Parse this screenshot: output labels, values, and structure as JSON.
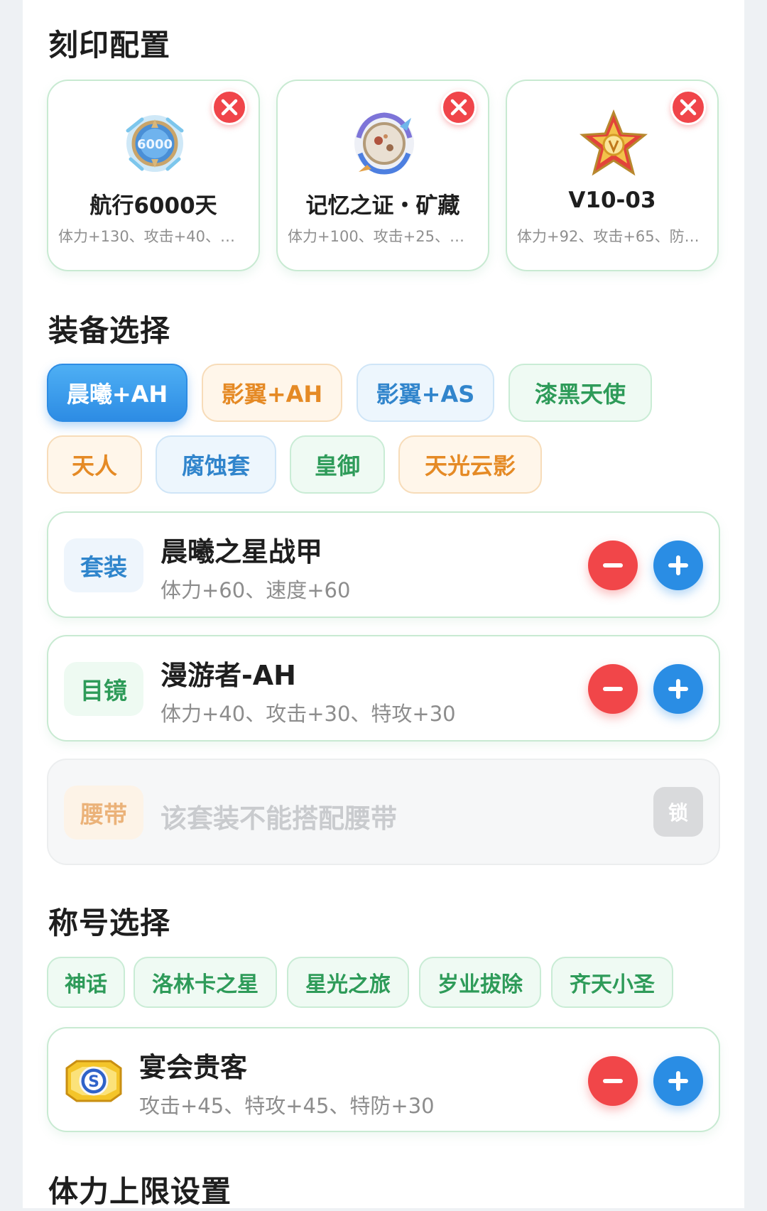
{
  "imprint": {
    "title": "刻印配置",
    "cards": [
      {
        "name": "航行6000天",
        "stats": "体力+130、攻击+40、…",
        "icon": "voyage-medal-icon"
      },
      {
        "name": "记忆之证・矿藏",
        "stats": "体力+100、攻击+25、…",
        "icon": "memory-ore-medal-icon"
      },
      {
        "name": "V10-03",
        "stats": "体力+92、攻击+65、防…",
        "icon": "star-badge-icon"
      }
    ]
  },
  "equipment": {
    "title": "装备选择",
    "sets": [
      "晨曦+AH",
      "影翼+AH",
      "影翼+AS",
      "漆黑天使",
      "天人",
      "腐蚀套",
      "皇御",
      "天光云影"
    ],
    "selected_set": "晨曦+AH",
    "slots": [
      {
        "tag": "套装",
        "name": "晨曦之星战甲",
        "stats": "体力+60、速度+60"
      },
      {
        "tag": "目镜",
        "name": "漫游者-AH",
        "stats": "体力+40、攻击+30、特攻+30"
      },
      {
        "tag": "腰带",
        "disabled_text": "该套装不能搭配腰带",
        "lock_label": "锁"
      }
    ]
  },
  "titles": {
    "title": "称号选择",
    "options": [
      "神话",
      "洛林卡之星",
      "星光之旅",
      "岁业拔除",
      "齐天小圣"
    ],
    "current": {
      "name": "宴会贵客",
      "stats": "攻击+45、特攻+45、特防+30",
      "icon": "golden-s-badge-icon"
    }
  },
  "stamina": {
    "title": "体力上限设置"
  },
  "colors": {
    "accent_blue": "#2a8de4",
    "danger_red": "#f14649",
    "green_text": "#2e9b59",
    "orange_text": "#e58a25"
  }
}
